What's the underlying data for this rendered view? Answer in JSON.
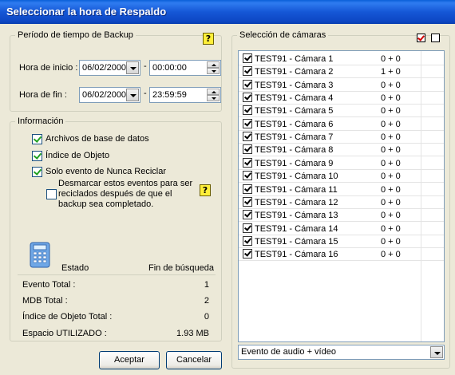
{
  "window": {
    "title": "Seleccionar la hora de Respaldo"
  },
  "backup_period": {
    "legend": "Período de tiempo de Backup",
    "help_icon": "?",
    "start": {
      "label": "Hora de inicio :",
      "date": "06/02/2000",
      "sep": "-",
      "time": "00:00:00"
    },
    "end": {
      "label": "Hora de fin :",
      "date": "06/02/2000",
      "sep": "-",
      "time": "23:59:59"
    }
  },
  "info": {
    "legend": "Información",
    "options": [
      {
        "label": "Archivos de base de datos",
        "checked": true
      },
      {
        "label": "Índice de Objeto",
        "checked": true
      },
      {
        "label": "Solo evento de Nunca Reciclar",
        "checked": true
      }
    ],
    "uncheck_note": {
      "line1": "Desmarcar estos eventos para ser",
      "line2": "reciclados después de que el",
      "line3": "backup sea completado.",
      "checked": false
    },
    "help_icon": "?",
    "icon": "calculator-icon",
    "status_label": "Estado",
    "status_value": "Fin de búsqueda",
    "stats": [
      {
        "label": "Evento Total :",
        "value": "1"
      },
      {
        "label": "MDB Total :",
        "value": "2"
      },
      {
        "label": "Índice de Objeto Total :",
        "value": "0"
      },
      {
        "label": "Espacio UTILIZADO :",
        "value": "1.93 MB"
      }
    ]
  },
  "buttons": {
    "accept": "Aceptar",
    "cancel": "Cancelar"
  },
  "cameras": {
    "legend": "Selección de cámaras",
    "select_all_icon": "check-all-icon",
    "clear_all_icon": "uncheck-all-icon",
    "rows": [
      {
        "name": "TEST91 - Cámara 1",
        "count": "0 + 0",
        "checked": true
      },
      {
        "name": "TEST91 - Cámara 2",
        "count": "1 + 0",
        "checked": true
      },
      {
        "name": "TEST91 - Cámara 3",
        "count": "0 + 0",
        "checked": true
      },
      {
        "name": "TEST91 - Cámara 4",
        "count": "0 + 0",
        "checked": true
      },
      {
        "name": "TEST91 - Cámara 5",
        "count": "0 + 0",
        "checked": true
      },
      {
        "name": "TEST91 - Cámara 6",
        "count": "0 + 0",
        "checked": true
      },
      {
        "name": "TEST91 - Cámara 7",
        "count": "0 + 0",
        "checked": true
      },
      {
        "name": "TEST91 - Cámara 8",
        "count": "0 + 0",
        "checked": true
      },
      {
        "name": "TEST91 - Cámara 9",
        "count": "0 + 0",
        "checked": true
      },
      {
        "name": "TEST91 - Cámara 10",
        "count": "0 + 0",
        "checked": true
      },
      {
        "name": "TEST91 - Cámara 11",
        "count": "0 + 0",
        "checked": true
      },
      {
        "name": "TEST91 - Cámara 12",
        "count": "0 + 0",
        "checked": true
      },
      {
        "name": "TEST91 - Cámara 13",
        "count": "0 + 0",
        "checked": true
      },
      {
        "name": "TEST91 - Cámara 14",
        "count": "0 + 0",
        "checked": true
      },
      {
        "name": "TEST91 - Cámara 15",
        "count": "0 + 0",
        "checked": true
      },
      {
        "name": "TEST91 - Cámara 16",
        "count": "0 + 0",
        "checked": true
      }
    ],
    "event_filter": "Evento de audio + vídeo"
  }
}
